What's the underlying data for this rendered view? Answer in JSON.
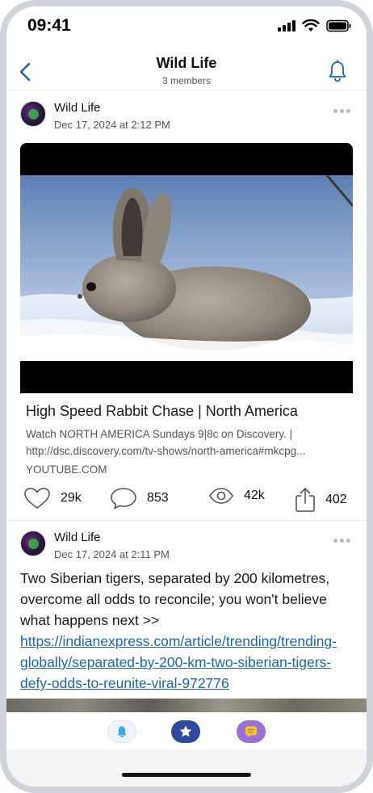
{
  "status_bar": {
    "time": "09:41"
  },
  "header": {
    "title": "Wild Life",
    "subtitle": "3 members"
  },
  "posts": [
    {
      "author": "Wild Life",
      "timestamp": "Dec 17, 2024 at 2:12 PM",
      "link_preview": {
        "title": "High Speed Rabbit Chase | North America",
        "description": "Watch NORTH AMERICA Sundays 9|8c on Discovery. | http://dsc.discovery.com/tv-shows/north-america#mkcpg...",
        "domain": "YOUTUBE.COM"
      },
      "stats": {
        "likes": "29k",
        "comments": "853",
        "views": "42k",
        "shares": "402"
      }
    },
    {
      "author": "Wild Life",
      "timestamp": "Dec 17, 2024 at 2:11 PM",
      "text": "Two Siberian tigers, separated by 200 kilometres, overcome all odds to reconcile; you won't believe what happens next >> ",
      "link": "https://indianexpress.com/article/trending/trending-globally/separated-by-200-km-two-siberian-tigers-defy-odds-to-reunite-viral-972776"
    }
  ],
  "icons": {
    "back": "chevron-left-icon",
    "notifications": "bell-icon",
    "like": "heart-icon",
    "comment": "comment-bubble-icon",
    "views": "eye-icon",
    "share": "share-icon",
    "tab_1": "bell-icon",
    "tab_2": "star-icon",
    "tab_3": "message-icon"
  },
  "colors": {
    "accent": "#1d67a8",
    "tab_bell": "#35a9e0",
    "tab_star": "#2e4a9e",
    "tab_message": "#9b6fd6",
    "message_glyph": "#f2c23a"
  }
}
